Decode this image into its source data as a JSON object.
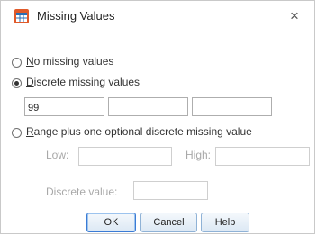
{
  "window": {
    "title": "Missing Values",
    "close_glyph": "×",
    "icon": "spss-table-icon"
  },
  "options": {
    "no_missing": {
      "prefix": "",
      "mnemonic": "N",
      "rest": "o missing values",
      "selected": false
    },
    "discrete": {
      "prefix": "",
      "mnemonic": "D",
      "rest": "iscrete missing values",
      "selected": true
    },
    "range": {
      "prefix": "",
      "mnemonic": "R",
      "rest": "ange plus one optional discrete missing value",
      "selected": false
    }
  },
  "discrete_values": [
    "99",
    "",
    ""
  ],
  "range": {
    "low_label": "Low:",
    "low_value": "",
    "high_label": "High:",
    "high_value": "",
    "discrete_label": "Discrete value:",
    "discrete_value": ""
  },
  "buttons": {
    "ok": "OK",
    "cancel": "Cancel",
    "help": "Help"
  },
  "colors": {
    "button_border": "#8fb2d6",
    "default_button_border": "#3a7bd5",
    "disabled_text": "#a8a8a8"
  }
}
